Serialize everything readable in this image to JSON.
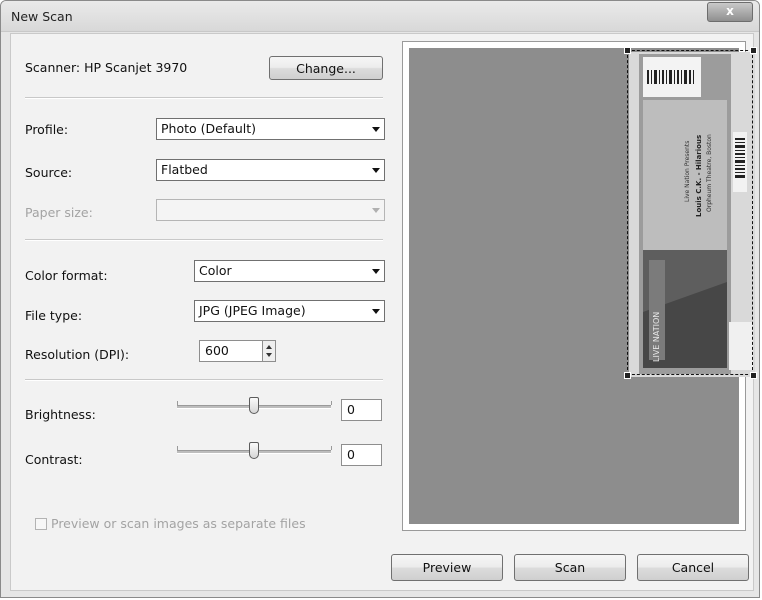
{
  "window": {
    "title": "New Scan",
    "close_glyph": "x"
  },
  "scanner": {
    "label": "Scanner: HP Scanjet 3970",
    "change_button": "Change..."
  },
  "profile": {
    "label": "Profile:",
    "value": "Photo (Default)"
  },
  "source": {
    "label": "Source:",
    "value": "Flatbed"
  },
  "paper_size": {
    "label": "Paper size:",
    "value": "",
    "disabled": true
  },
  "color_format": {
    "label": "Color format:",
    "value": "Color"
  },
  "file_type": {
    "label": "File type:",
    "value": "JPG (JPEG Image)"
  },
  "resolution": {
    "label": "Resolution (DPI):",
    "value": "600"
  },
  "brightness": {
    "label": "Brightness:",
    "value": "0",
    "range": [
      -100,
      100
    ]
  },
  "contrast": {
    "label": "Contrast:",
    "value": "0",
    "range": [
      -100,
      100
    ]
  },
  "separate_files": {
    "label": "Preview or scan images as separate files",
    "checked": false,
    "disabled": true
  },
  "buttons": {
    "preview": "Preview",
    "scan": "Scan",
    "cancel": "Cancel"
  },
  "preview_image": {
    "barcode_text": "||||||||||||||||",
    "ticket_text_1": "Live Nation Presents",
    "ticket_text_2": "Louis C.K. - Hilarious",
    "ticket_text_3": "Orpheum Theatre, Boston",
    "stub_text": "LIVE NATION"
  },
  "colors": {
    "preview_background": "#8d8d8d",
    "dialog_background": "#f2f2f2"
  }
}
